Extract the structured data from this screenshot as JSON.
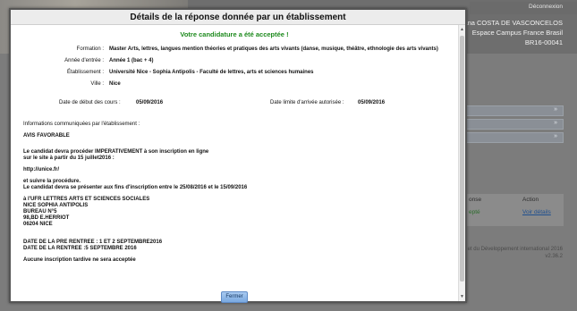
{
  "background": {
    "deconnexion": "Déconnexion",
    "user_lines": [
      "iana COSTA DE VASCONCELOS",
      "Espace Campus France Brasil",
      "BR16-00041"
    ],
    "table_headers": [
      "onse",
      "Action"
    ],
    "table_values": [
      "epté",
      "Voir détails"
    ],
    "footer_lines": [
      "e et du Développement international 2016",
      "v2.36.2"
    ],
    "bar_chevron": "»"
  },
  "modal": {
    "title": "Détails de la réponse donnée par un établissement",
    "success": "Votre candidature a été acceptée !",
    "fields": [
      {
        "label": "Formation :",
        "value": "Master Arts, lettres, langues mention théories et pratiques des arts vivants (danse, musique, théâtre, ethnologie des arts vivants)"
      },
      {
        "label": "Année d'entrée :",
        "value": "Année 1 (bac + 4)"
      },
      {
        "label": "Établissement :",
        "value": "Université Nice - Sophia Antipolis - Faculté de lettres, arts et sciences humaines"
      },
      {
        "label": "Ville :",
        "value": "Nice"
      }
    ],
    "date_debut_label": "Date de début des cours :",
    "date_debut_value": "05/09/2016",
    "date_limite_label": "Date limite d'arrivée autorisée :",
    "date_limite_value": "05/09/2016",
    "infos_label": "Informations communiquées par l'établissement :",
    "avis": "AVIS FAVORABLE",
    "paragraph1": [
      "Le candidat devra procéder IMPERATIVEMENT à son inscription en ligne",
      "sur le site à partir du 15 juillet2016 :"
    ],
    "url": "http://unice.fr/",
    "paragraph2": [
      "et suivre la procédure.",
      "Le candidat devra se présenter aux fins d'inscription entre le 25/08/2016 et le 15/09/2016"
    ],
    "address": [
      "à l'UFR LETTRES ARTS ET SCIENCES SOCIALES",
      "NICE SOPHIA ANTIPOLIS",
      "BUREAU N°5",
      "98,BD E.HERRIOT",
      "06204 NICE"
    ],
    "rentree": [
      "DATE DE LA PRE RENTREE : 1 ET 2 SEPTEMBRE2016",
      "DATE DE LA RENTREE :5 SEPTEMBRE 2016"
    ],
    "tardive": "Aucune inscription tardive ne sera acceptée",
    "close_button": "Fermer"
  },
  "colors": {
    "success": "#1d8a1d",
    "button": "#7aa8e0",
    "link": "#3b78c4"
  }
}
